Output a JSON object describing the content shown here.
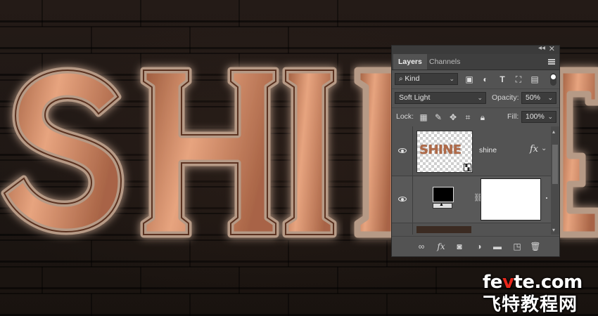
{
  "canvas": {
    "text": "SHINE",
    "visible_letters": "SHI"
  },
  "panel": {
    "tabs": [
      {
        "label": "Layers",
        "active": true
      },
      {
        "label": "Channels",
        "active": false
      }
    ],
    "filter": {
      "kind_label": "Kind"
    },
    "blend_mode": "Soft Light",
    "opacity_label": "Opacity:",
    "opacity_value": "50%",
    "lock_label": "Lock:",
    "fill_label": "Fill:",
    "fill_value": "100%",
    "layers": [
      {
        "name": "shine",
        "thumb_text": "SHINE",
        "fx": "fx",
        "visible": true,
        "type": "smart-object-text"
      },
      {
        "name": "",
        "visible": true,
        "type": "adjustment-with-mask"
      }
    ]
  },
  "icons": {
    "search": "search-icon",
    "image_filter": "image-filter-icon",
    "adjustment_filter": "adjustment-filter-icon",
    "type_filter": "type-filter-icon",
    "shape_filter": "shape-filter-icon",
    "smart_filter": "smart-object-filter-icon"
  },
  "watermark": {
    "line1_a": "fe",
    "line1_b": "v",
    "line1_c": "te.com",
    "line2": "飞特教程网"
  },
  "colors": {
    "panel_bg": "#535353",
    "copper": "#c98a66",
    "watermark_red": "#e8281c"
  }
}
